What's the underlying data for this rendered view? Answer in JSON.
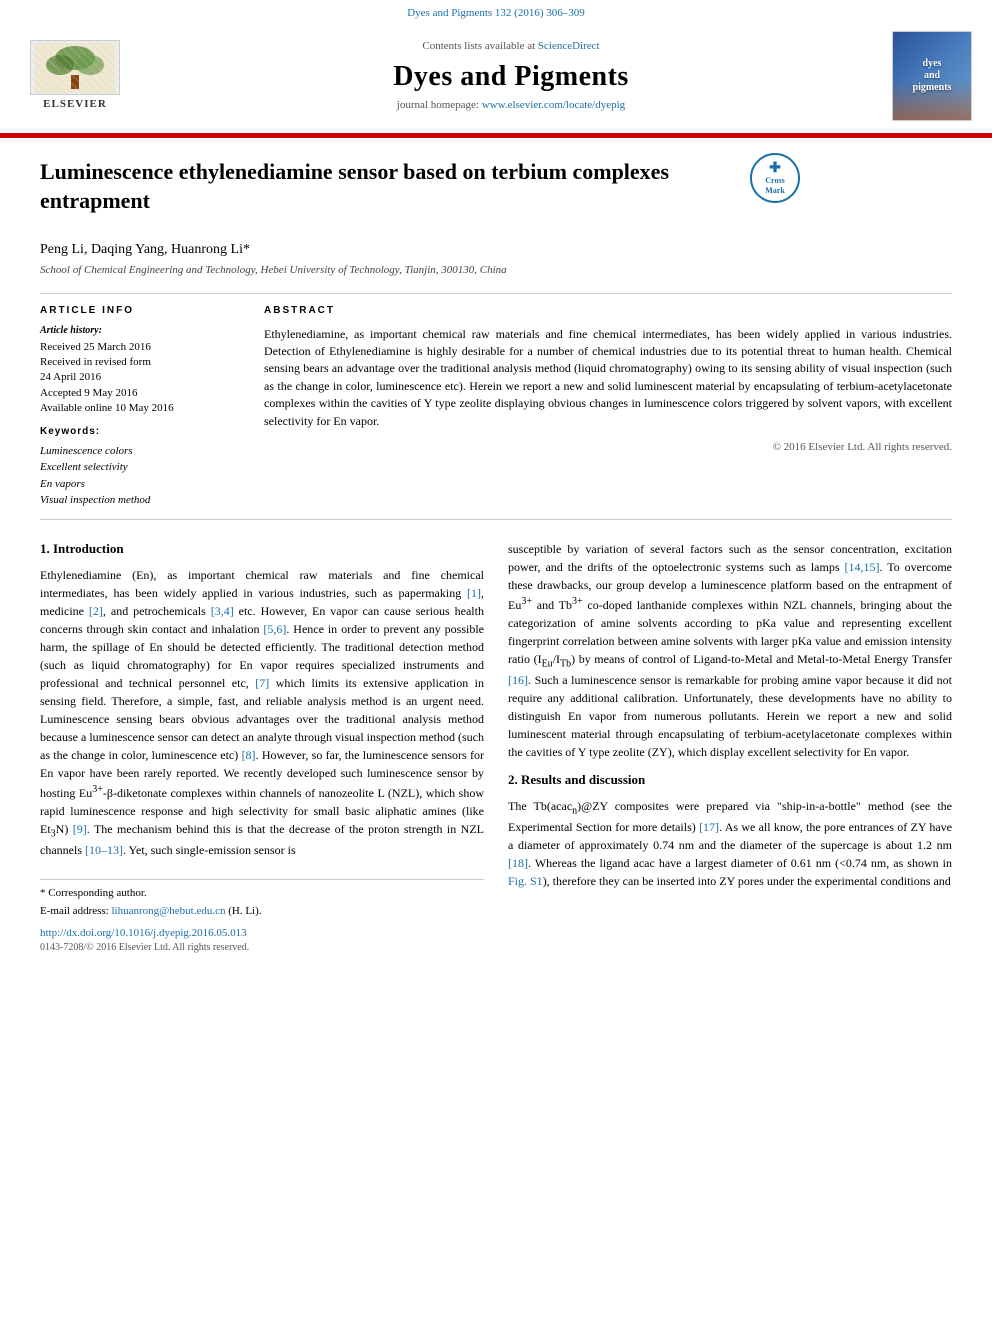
{
  "header": {
    "top_bar": "Dyes and Pigments 132 (2016) 306–309",
    "contents_available": "Contents lists available at",
    "science_direct": "ScienceDirect",
    "journal_name": "Dyes and Pigments",
    "homepage_prefix": "journal homepage:",
    "homepage_url": "www.elsevier.com/locate/dyepig",
    "elsevier_label": "ELSEVIER",
    "thumbnail_text": "dyes and pigments"
  },
  "article": {
    "title": "Luminescence ethylenediamine sensor based on terbium complexes entrapment",
    "authors": "Peng Li, Daqing Yang, Huanrong Li*",
    "affiliation": "School of Chemical Engineering and Technology, Hebei University of Technology, Tianjin, 300130, China",
    "crossmark_label": "Cross\nMark"
  },
  "article_info": {
    "section_title": "ARTICLE INFO",
    "history_title": "Article history:",
    "received": "Received 25 March 2016",
    "received_revised": "Received in revised form",
    "received_revised_date": "24 April 2016",
    "accepted": "Accepted 9 May 2016",
    "available_online": "Available online 10 May 2016",
    "keywords_title": "Keywords:",
    "kw1": "Luminescence colors",
    "kw2": "Excellent selectivity",
    "kw3": "En vapors",
    "kw4": "Visual inspection method"
  },
  "abstract": {
    "title": "ABSTRACT",
    "text": "Ethylenediamine, as important chemical raw materials and fine chemical intermediates, has been widely applied in various industries. Detection of Ethylenediamine is highly desirable for a number of chemical industries due to its potential threat to human health. Chemical sensing bears an advantage over the traditional analysis method (liquid chromatography) owing to its sensing ability of visual inspection (such as the change in color, luminescence etc). Herein we report a new and solid luminescent material by encapsulating of terbium-acetylacetonate complexes within the cavities of Y type zeolite displaying obvious changes in luminescence colors triggered by solvent vapors, with excellent selectivity for En vapor.",
    "copyright": "© 2016 Elsevier Ltd. All rights reserved."
  },
  "section1": {
    "title": "1. Introduction",
    "paragraphs": [
      "Ethylenediamine (En), as important chemical raw materials and fine chemical intermediates, has been widely applied in various industries, such as papermaking [1], medicine [2], and petrochemicals [3,4] etc. However, En vapor can cause serious health concerns through skin contact and inhalation [5,6]. Hence in order to prevent any possible harm, the spillage of En should be detected efficiently. The traditional detection method (such as liquid chromatography) for En vapor requires specialized instruments and professional and technical personnel etc, [7] which limits its extensive application in sensing field. Therefore, a simple, fast, and reliable analysis method is an urgent need. Luminescence sensing bears obvious advantages over the traditional analysis method because a luminescence sensor can detect an analyte through visual inspection method (such as the change in color, luminescence etc) [8]. However, so far, the luminescence sensors for En vapor have been rarely reported. We recently developed such luminescence sensor by hosting Eu³⁺-β-diketonate complexes within channels of nanozeolite L (NZL), which show rapid luminescence response and high selectivity for small basic aliphatic amines (like Et₃N) [9]. The mechanism behind this is that the decrease of the proton strength in NZL channels [10–13]. Yet, such single-emission sensor is"
    ]
  },
  "section1_right": {
    "paragraphs": [
      "susceptible by variation of several factors such as the sensor concentration, excitation power, and the drifts of the optoelectronic systems such as lamps [14,15]. To overcome these drawbacks, our group develop a luminescence platform based on the entrapment of Eu³⁺ and Tb³⁺ co-doped lanthanide complexes within NZL channels, bringing about the categorization of amine solvents according to pKa value and representing excellent fingerprint correlation between amine solvents with larger pKa value and emission intensity ratio (IEu/ITb) by means of control of Ligand-to-Metal and Metal-to-Metal Energy Transfer [16]. Such a luminescence sensor is remarkable for probing amine vapor because it did not require any additional calibration. Unfortunately, these developments have no ability to distinguish En vapor from numerous pollutants. Herein we report a new and solid luminescent material through encapsulating of terbium-acetylacetonate complexes within the cavities of Y type zeolite (ZY), which display excellent selectivity for En vapor."
    ]
  },
  "section2": {
    "title": "2. Results and discussion",
    "paragraphs": [
      "The Tb(acac₃)@ZY composites were prepared via \"ship-in-a-bottle\" method (see the Experimental Section for more details) [17]. As we all know, the pore entrances of ZY have a diameter of approximately 0.74 nm and the diameter of the supercage is about 1.2 nm [18]. Whereas the ligand acac have a largest diameter of 0.61 nm (<0.74 nm, as shown in Fig. S1), therefore they can be inserted into ZY pores under the experimental conditions and"
    ]
  },
  "footnotes": {
    "corresponding": "* Corresponding author.",
    "email_label": "E-mail address:",
    "email": "lihuanrong@hebut.edu.cn",
    "email_suffix": "(H. Li).",
    "doi": "http://dx.doi.org/10.1016/j.dyepig.2016.05.013",
    "issn": "0143-7208/© 2016 Elsevier Ltd. All rights reserved."
  }
}
